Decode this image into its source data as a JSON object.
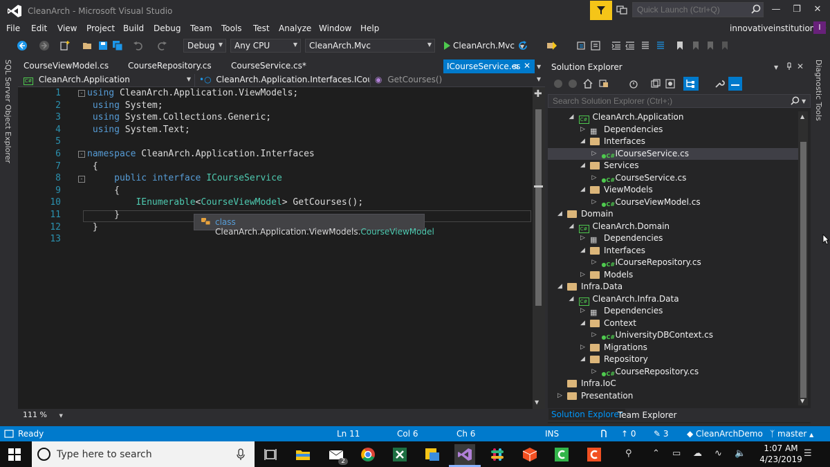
{
  "window": {
    "title": "CleanArch - Microsoft Visual Studio",
    "quick_launch_placeholder": "Quick Launch (Ctrl+Q)",
    "account": "innovativeinstitution",
    "account_initial": "I"
  },
  "menu": [
    "File",
    "Edit",
    "View",
    "Project",
    "Build",
    "Debug",
    "Team",
    "Tools",
    "Test",
    "Analyze",
    "Window",
    "Help"
  ],
  "toolbar": {
    "configuration": "Debug",
    "platform": "Any CPU",
    "startup_project": "CleanArch.Mvc",
    "run_label": "CleanArch.Mvc"
  },
  "left_strip": {
    "label": "SQL Server Object Explorer"
  },
  "right_strip": {
    "label": "Diagnostic Tools"
  },
  "editor_tabs": [
    {
      "label": "CourseViewModel.cs"
    },
    {
      "label": "CourseRepository.cs"
    },
    {
      "label": "CourseService.cs*"
    }
  ],
  "active_tab": {
    "label": "ICourseService.cs"
  },
  "navbar": {
    "project": "CleanArch.Application",
    "type": "CleanArch.Application.Interfaces.ICourseSen",
    "member": "GetCourses()"
  },
  "code": {
    "line_numbers": [
      "1",
      "2",
      "3",
      "4",
      "5",
      "6",
      "7",
      "8",
      "9",
      "10",
      "11",
      "12",
      "13"
    ],
    "tooltip": {
      "kind": "class",
      "namespace": "CleanArch.Application.ViewModels.",
      "type": "CourseViewModel"
    }
  },
  "editor": {
    "zoom": "111 %"
  },
  "solution_explorer": {
    "title": "Solution Explorer",
    "search_placeholder": "Search Solution Explorer (Ctrl+;)",
    "items": [
      {
        "label": "CleanArch.Application"
      },
      {
        "label": "Dependencies"
      },
      {
        "label": "Interfaces"
      },
      {
        "label": "ICourseService.cs"
      },
      {
        "label": "Services"
      },
      {
        "label": "CourseService.cs"
      },
      {
        "label": "ViewModels"
      },
      {
        "label": "CourseViewModel.cs"
      },
      {
        "label": "Domain"
      },
      {
        "label": "CleanArch.Domain"
      },
      {
        "label": "Dependencies"
      },
      {
        "label": "Interfaces"
      },
      {
        "label": "ICourseRepository.cs"
      },
      {
        "label": "Models"
      },
      {
        "label": "Infra.Data"
      },
      {
        "label": "CleanArch.Infra.Data"
      },
      {
        "label": "Dependencies"
      },
      {
        "label": "Context"
      },
      {
        "label": "UniversityDBContext.cs"
      },
      {
        "label": "Migrations"
      },
      {
        "label": "Repository"
      },
      {
        "label": "CourseRepository.cs"
      },
      {
        "label": "Infra.IoC"
      },
      {
        "label": "Presentation"
      }
    ],
    "tabs": [
      "Solution Explorer",
      "Team Explorer"
    ]
  },
  "status": {
    "ready": "Ready",
    "line": "Ln 11",
    "col": "Col 6",
    "ch": "Ch 6",
    "mode": "INS",
    "up_count": "0",
    "edit_count": "3",
    "repo": "CleanArchDemo",
    "branch": "master"
  },
  "taskbar": {
    "search_placeholder": "Type here to search",
    "mail_badge": "2",
    "time": "1:07 AM",
    "date": "4/23/2019"
  },
  "colors": {
    "accent": "#007acc",
    "keyword": "#569cd6",
    "type": "#4ec9b0",
    "line_number": "#2b91af",
    "filter_button": "#f5c518"
  }
}
